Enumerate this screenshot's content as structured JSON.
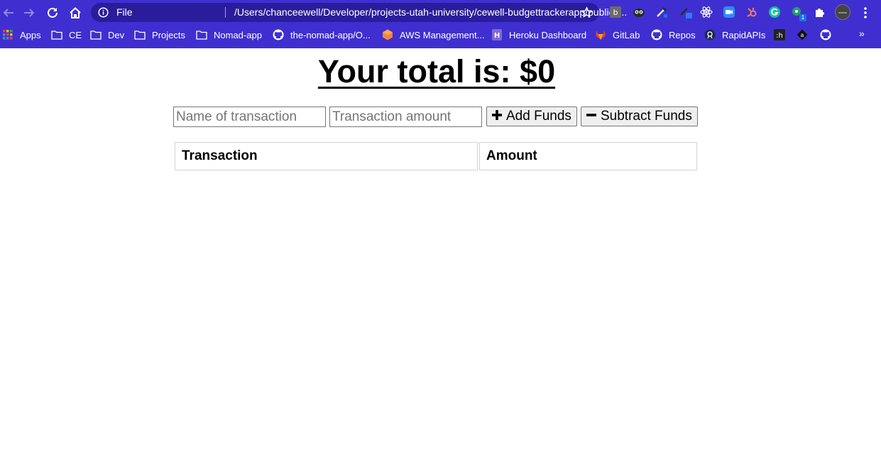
{
  "browser": {
    "scheme_label": "File",
    "url": "/Users/chanceewell/Developer/projects-utah-university/cewell-budgettrackerapp/public/i...",
    "accent": "#3f2fd1",
    "nav": [
      "back-icon",
      "forward-icon",
      "reload-icon",
      "home-icon"
    ],
    "extensions": [
      "hubspot-ext-icon",
      "owl-ext-icon",
      "eyedropper-ext-icon",
      "color-picker-ext-icon",
      "react-devtools-icon",
      "zoom-ext-icon",
      "hubspot-sprocket-icon",
      "grammarly-icon",
      "chat-ext-icon",
      "extensions-puzzle-icon"
    ],
    "extension_badge": "1"
  },
  "bookmarks": [
    {
      "label": "Apps",
      "icon": "apps-grid-icon"
    },
    {
      "label": "CE",
      "icon": "folder-icon"
    },
    {
      "label": "Dev",
      "icon": "folder-icon"
    },
    {
      "label": "Projects",
      "icon": "folder-icon"
    },
    {
      "label": "Nomad-app",
      "icon": "folder-icon"
    },
    {
      "label": "the-nomad-app/O...",
      "icon": "github-icon"
    },
    {
      "label": "AWS Management...",
      "icon": "aws-icon"
    },
    {
      "label": "Heroku Dashboard",
      "icon": "heroku-icon"
    },
    {
      "label": "GitLab",
      "icon": "gitlab-icon"
    },
    {
      "label": "Repos",
      "icon": "github-icon"
    },
    {
      "label": "RapidAPIs",
      "icon": "rapidapi-icon"
    },
    {
      "label": "",
      "icon": "hashnode-icon"
    },
    {
      "label": "",
      "icon": "amazon-icon"
    },
    {
      "label": "",
      "icon": "github-icon"
    }
  ],
  "page": {
    "total_label": "Your total is: $0",
    "name_placeholder": "Name of transaction",
    "amount_placeholder": "Transaction amount",
    "add_label": "Add Funds",
    "subtract_label": "Subtract Funds",
    "columns": [
      "Transaction",
      "Amount"
    ]
  }
}
